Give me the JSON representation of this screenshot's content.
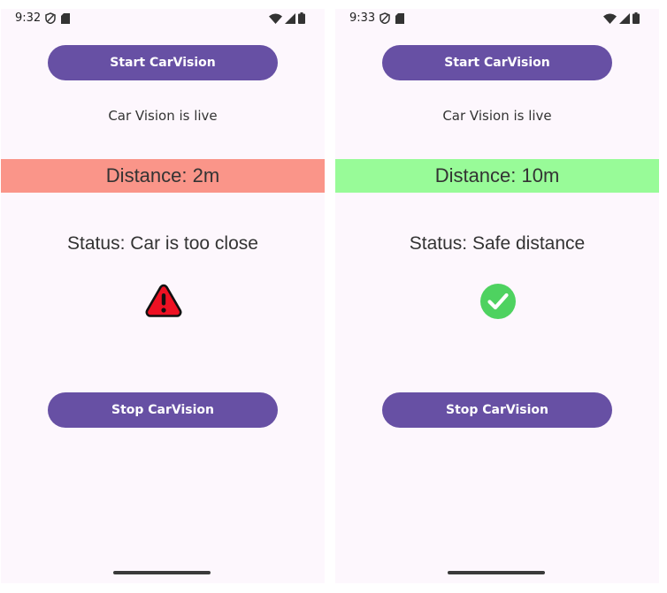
{
  "screens": [
    {
      "status_bar": {
        "time": "9:32"
      },
      "start_button": "Start CarVision",
      "live_text": "Car Vision is live",
      "distance": "Distance: 2m",
      "distance_color": "#fa9589",
      "status": "Status: Car is too close",
      "status_icon": "warning-icon",
      "stop_button": "Stop CarVision"
    },
    {
      "status_bar": {
        "time": "9:33"
      },
      "start_button": "Start CarVision",
      "live_text": "Car Vision is live",
      "distance": "Distance: 10m",
      "distance_color": "#98fb98",
      "status": "Status: Safe distance",
      "status_icon": "check-circle-icon",
      "stop_button": "Stop CarVision"
    }
  ],
  "colors": {
    "primary": "#6750a4",
    "background": "#fdf7fd",
    "warning_red": "#ee1123",
    "success_green": "#4ed260"
  }
}
